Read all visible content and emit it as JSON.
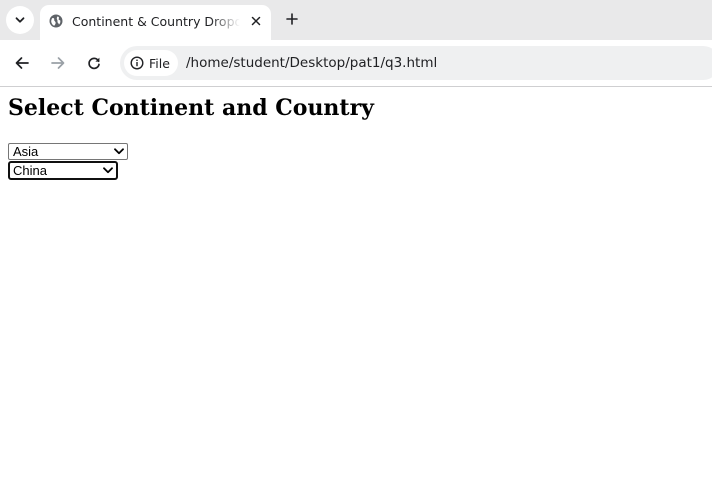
{
  "browser": {
    "tab": {
      "title": "Continent & Country Dropdown"
    },
    "address_bar": {
      "site_chip_label": "File",
      "url": "/home/student/Desktop/pat1/q3.html"
    }
  },
  "page": {
    "heading": "Select Continent and Country",
    "continent_select": {
      "selected": "Asia"
    },
    "country_select": {
      "selected": "China"
    }
  },
  "icons": {
    "tab_search": "chevron-down-icon",
    "favicon": "globe-icon",
    "tab_close": "close-icon",
    "new_tab": "plus-icon",
    "back": "arrow-left-icon",
    "forward": "arrow-right-icon",
    "reload": "reload-icon",
    "site_info": "info-icon"
  },
  "colors": {
    "tab_strip_bg": "#e9e9ea",
    "omnibox_bg": "#eff0f1",
    "text": "#202124",
    "forward_disabled": "#9aa0a6"
  }
}
